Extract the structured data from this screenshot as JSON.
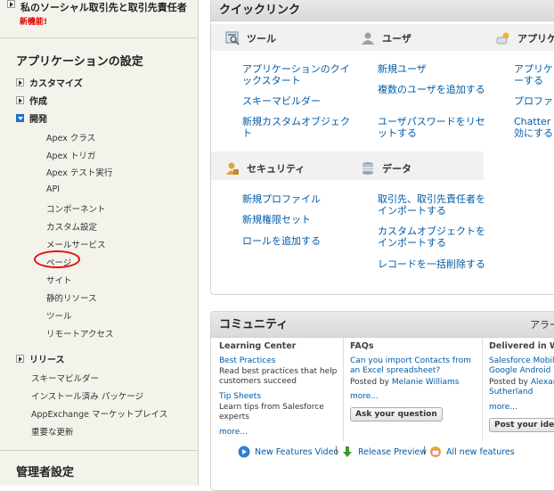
{
  "sidebar": {
    "top_item": "私のソーシャル取引先と取引先責任者",
    "top_new_badge": "新機能!",
    "app_settings_title": "アプリケーションの設定",
    "categories": [
      {
        "label": "カスタマイズ",
        "state": "collapsed"
      },
      {
        "label": "作成",
        "state": "collapsed"
      },
      {
        "label": "開発",
        "state": "expanded"
      }
    ],
    "dev_items": [
      "Apex クラス",
      "Apex トリガ",
      "Apex テスト実行",
      "API",
      "コンポーネント",
      "カスタム設定",
      "メールサービス",
      "ページ",
      "サイト",
      "静的リソース",
      "ツール",
      "リモートアクセス"
    ],
    "release_label": "リリース",
    "other_items": [
      "スキーマビルダー",
      "インストール済み パッケージ",
      "AppExchange マーケットプレイス",
      "重要な更新"
    ],
    "admin_title": "管理者設定"
  },
  "quicklinks": {
    "title": "クイックリンク",
    "tools": {
      "title": "ツール",
      "links": [
        "アプリケーションのクイックスタート",
        "スキーマビルダー",
        "新規カスタムオブジェクト"
      ]
    },
    "users": {
      "title": "ユーザ",
      "links": [
        "新規ユーザ",
        "複数のユーザを追加する",
        "ユーザパスワードをリセットする"
      ]
    },
    "apps": {
      "title": "アプリケ",
      "links": [
        "アプリケーする",
        "プロファイ",
        "Chatter 効にする"
      ]
    },
    "security": {
      "title": "セキュリティ",
      "links": [
        "新規プロファイル",
        "新規権限セット",
        "ロールを追加する"
      ]
    },
    "data": {
      "title": "データ",
      "links": [
        "取引先、取引先責任者をインポートする",
        "カスタムオブジェクトをインポートする",
        "レコードを一括削除する"
      ]
    }
  },
  "community": {
    "title": "コミュニティ",
    "right_label": "アラー",
    "learning": {
      "title": "Learning Center",
      "link1": "Best Practices",
      "text1": "Read best practices that help customers succeed",
      "link2": "Tip Sheets",
      "text2": "Learn tips from Salesforce experts",
      "more": "more..."
    },
    "faqs": {
      "title": "FAQs",
      "link": "Can you import Contacts from an Excel spreadsheet?",
      "posted_by": "Posted by",
      "author": "Melanie Williams",
      "more": "more...",
      "button": "Ask your question"
    },
    "delivered": {
      "title": "Delivered in Wi",
      "link": "Salesforce Mobile Google Android",
      "posted_by": "Posted by",
      "author": "Alexan Sutherland",
      "more": "more...",
      "button": "Post your idea"
    },
    "footer": {
      "video": "New Features Video",
      "preview": "Release Preview",
      "all": "All new features"
    }
  }
}
